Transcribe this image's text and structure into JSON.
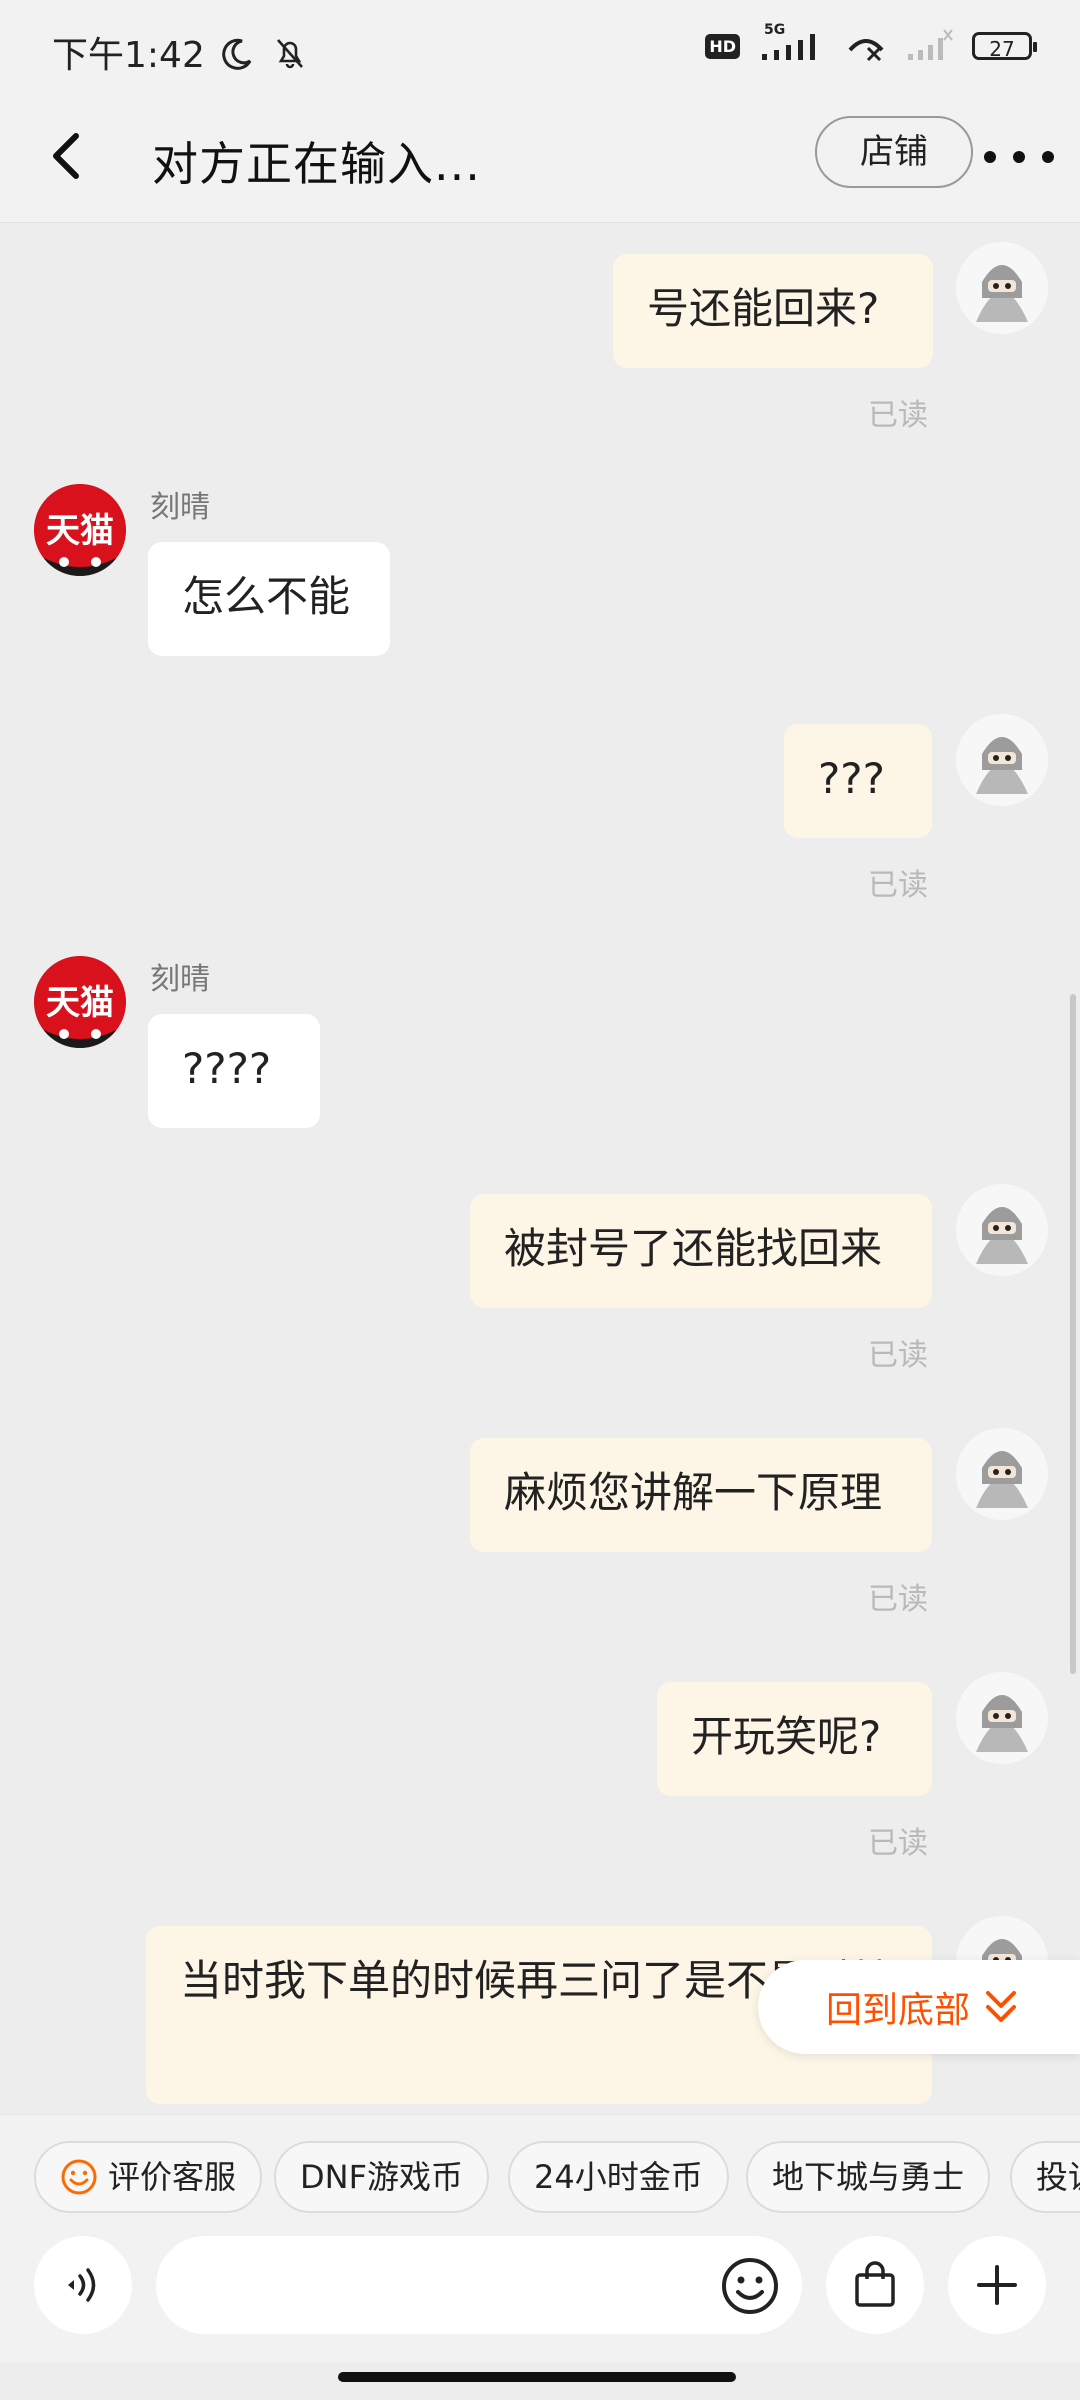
{
  "status_bar": {
    "time": "下午1:42",
    "battery": "27",
    "network_label": "5G",
    "hd_label": "HD"
  },
  "header": {
    "title": "对方正在输入...",
    "store_button": "店铺"
  },
  "shop_avatar_text": "天猫",
  "messages": [
    {
      "dir": "out",
      "text": "号还能回来?",
      "read": "已读"
    },
    {
      "dir": "in",
      "sender": "刻晴",
      "text": "怎么不能"
    },
    {
      "dir": "out",
      "text": "???",
      "read": "已读"
    },
    {
      "dir": "in",
      "sender": "刻晴",
      "text": "????"
    },
    {
      "dir": "out",
      "text": "被封号了还能找回来",
      "read": "已读"
    },
    {
      "dir": "out",
      "text": "麻烦您讲解一下原理",
      "read": "已读"
    },
    {
      "dir": "out",
      "text": "开玩笑呢?",
      "read": "已读"
    },
    {
      "dir": "out",
      "text": "当时我下单的时候再三问了是不是科技"
    }
  ],
  "back_to_bottom": "回到底部",
  "quick_replies": [
    "评价客服",
    "DNF游戏币",
    "24小时金币",
    "地下城与勇士",
    "投诉"
  ],
  "input": {
    "placeholder": ""
  },
  "colors": {
    "accent": "#ff5000",
    "outgoing_bubble": "#fdf6e7",
    "incoming_bubble": "#ffffff",
    "tmall_red": "#d8111c"
  }
}
